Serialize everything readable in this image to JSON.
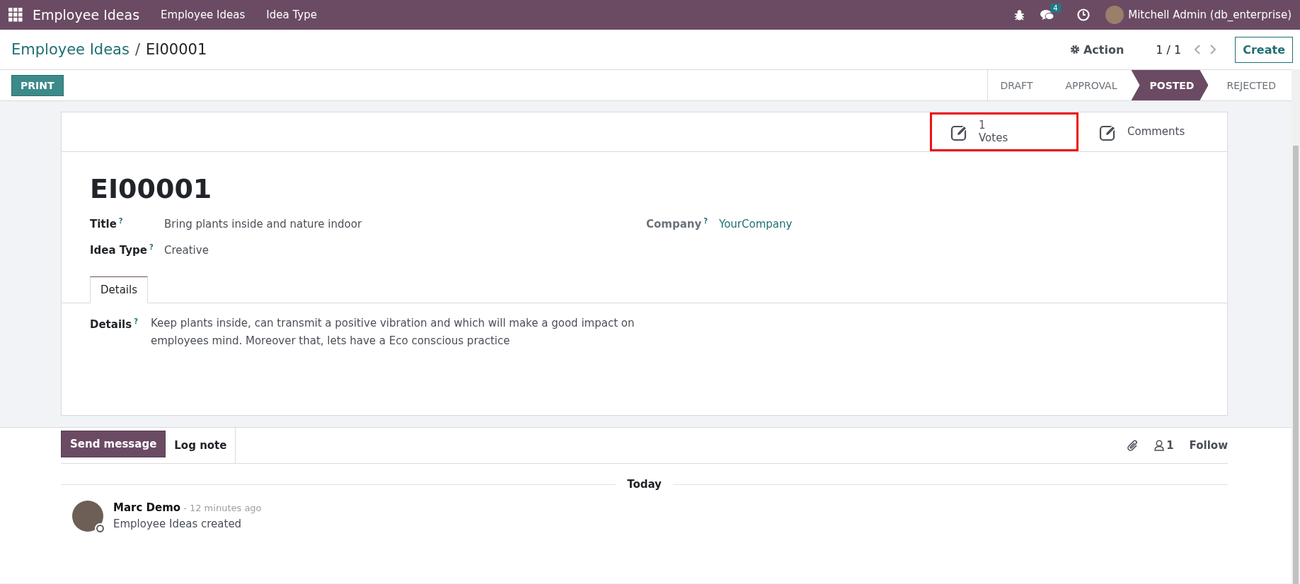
{
  "navbar": {
    "app_name": "Employee Ideas",
    "menu": [
      "Employee Ideas",
      "Idea Type"
    ],
    "message_count": "4",
    "user": "Mitchell Admin (db_enterprise)"
  },
  "breadcrumb": {
    "parent": "Employee Ideas",
    "separator": "/",
    "current": "EI00001"
  },
  "control_panel": {
    "action": "Action",
    "pager": "1 / 1",
    "create": "Create"
  },
  "status_bar": {
    "print": "PRINT",
    "stages": [
      {
        "label": "DRAFT",
        "selected": false
      },
      {
        "label": "APPROVAL",
        "selected": false
      },
      {
        "label": "POSTED",
        "selected": true
      },
      {
        "label": "REJECTED",
        "selected": false
      }
    ]
  },
  "smart_buttons": [
    {
      "value": "1",
      "label": "Votes",
      "highlighted": true
    },
    {
      "label": "Comments",
      "highlighted": false
    }
  ],
  "form": {
    "name": "EI00001",
    "help_mark": "?",
    "left_fields": [
      {
        "label": "Title",
        "value": "Bring plants inside and nature indoor",
        "kind": "text"
      },
      {
        "label": "Idea Type",
        "value": "Creative",
        "kind": "text"
      }
    ],
    "right_fields": [
      {
        "label": "Company",
        "value": "YourCompany",
        "kind": "link"
      }
    ],
    "tabs": [
      {
        "label": "Details",
        "selected": true
      }
    ],
    "details": {
      "label": "Details",
      "value": "Keep plants inside, can transmit a positive vibration and which will make a good impact on employees mind. Moreover that, lets have a Eco conscious practice"
    }
  },
  "chatter": {
    "buttons": [
      {
        "label": "Send message",
        "selected": true
      },
      {
        "label": "Log note",
        "selected": false
      }
    ],
    "followers": "1",
    "follow": "Follow",
    "date_separator": "Today",
    "messages": [
      {
        "author": "Marc Demo",
        "time": "- 12 minutes ago",
        "body": "Employee Ideas created"
      }
    ]
  }
}
